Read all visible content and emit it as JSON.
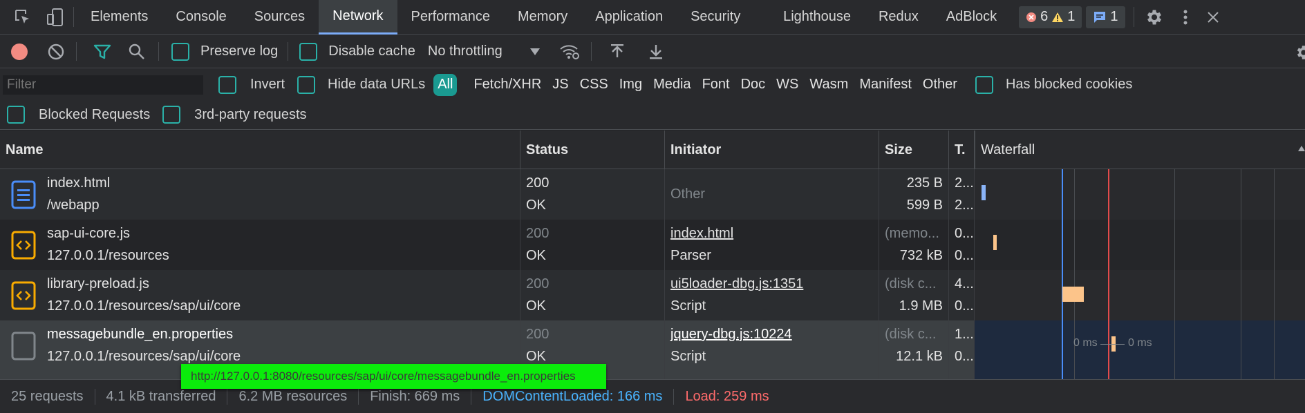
{
  "tabs": [
    "Elements",
    "Console",
    "Sources",
    "Network",
    "Performance",
    "Memory",
    "Application",
    "Security",
    "Lighthouse",
    "Redux",
    "AdBlock"
  ],
  "badges": {
    "errors": "6",
    "warnings": "1",
    "messages": "1"
  },
  "toolbar": {
    "preserve_log": "Preserve log",
    "disable_cache": "Disable cache",
    "throttling": "No throttling"
  },
  "filter": {
    "placeholder": "Filter",
    "invert": "Invert",
    "hide_data_urls": "Hide data URLs",
    "types": [
      "All",
      "Fetch/XHR",
      "JS",
      "CSS",
      "Img",
      "Media",
      "Font",
      "Doc",
      "WS",
      "Wasm",
      "Manifest",
      "Other"
    ],
    "has_blocked_cookies": "Has blocked cookies",
    "blocked_requests": "Blocked Requests",
    "third_party": "3rd-party requests"
  },
  "columns": {
    "name": "Name",
    "status": "Status",
    "initiator": "Initiator",
    "size": "Size",
    "time": "T.",
    "waterfall": "Waterfall"
  },
  "rows": [
    {
      "name": "index.html",
      "path": "/webapp",
      "status": "200",
      "status_text": "OK",
      "initiator": "Other",
      "initiator_type": "",
      "size1": "235 B",
      "size2": "599 B",
      "time1": "2...",
      "time2": "2..."
    },
    {
      "name": "sap-ui-core.js",
      "path": "127.0.0.1/resources",
      "status": "200",
      "status_text": "OK",
      "initiator": "index.html",
      "initiator_type": "Parser",
      "size1": "(memo...",
      "size2": "732 kB",
      "time1": "0...",
      "time2": "0..."
    },
    {
      "name": "library-preload.js",
      "path": "127.0.0.1/resources/sap/ui/core",
      "status": "200",
      "status_text": "OK",
      "initiator": "ui5loader-dbg.js:1351",
      "initiator_type": "Script",
      "size1": "(disk c...",
      "size2": "1.9 MB",
      "time1": "4...",
      "time2": "0..."
    },
    {
      "name": "messagebundle_en.properties",
      "path": "127.0.0.1/resources/sap/ui/core",
      "status": "200",
      "status_text": "OK",
      "initiator": "jquery-dbg.js:10224",
      "initiator_type": "Script",
      "size1": "(disk c...",
      "size2": "12.1 kB",
      "time1": "1...",
      "time2": "0..."
    }
  ],
  "waterfall_labels": {
    "left": "0 ms",
    "right": "0 ms"
  },
  "tooltip": "http://127.0.0.1:8080/resources/sap/ui/core/messagebundle_en.properties",
  "status": {
    "requests": "25 requests",
    "transferred": "4.1 kB transferred",
    "resources": "6.2 MB resources",
    "finish": "Finish: 669 ms",
    "dcl": "DOMContentLoaded: 166 ms",
    "load": "Load: 259 ms"
  },
  "colors": {
    "accent": "#7cacf8",
    "teal": "#2ab1a8",
    "dcl": "#4ab4ff",
    "load": "#ff6b6b",
    "record": "#f28b82"
  }
}
